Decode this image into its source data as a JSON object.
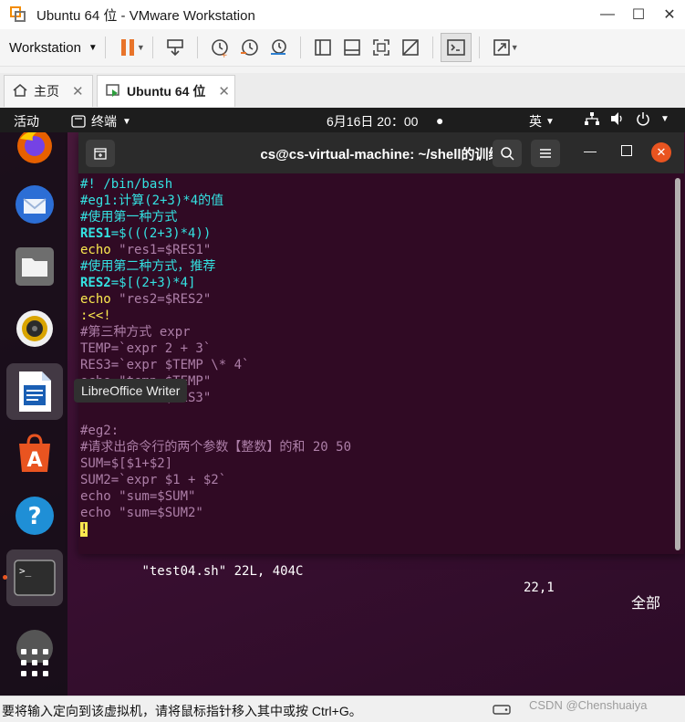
{
  "window": {
    "title": "Ubuntu 64 位 - VMware Workstation"
  },
  "toolbar": {
    "workstation_menu": "Workstation"
  },
  "tabs": [
    {
      "label": "主页"
    },
    {
      "label": "Ubuntu 64 位"
    }
  ],
  "ubuntu_bar": {
    "activities": "活动",
    "app_menu": "终端",
    "clock": "6月16日  20：00",
    "input_method": "英"
  },
  "dock": {
    "tooltip": "LibreOffice Writer"
  },
  "terminal": {
    "title": "cs@cs-virtual-machine: ~/shell的训练",
    "lines": {
      "l1": "#! /bin/bash",
      "l2": "#eg1:计算(2+3)*4的值",
      "l3": "#使用第一种方式",
      "l4a": "RES1",
      "l4b": "=$(((2+3)*4))",
      "l5a": "echo ",
      "l5b": "\"res1=$RES1\"",
      "l6": "#使用第二种方式，推荐",
      "l7a": "RES2",
      "l7b": "=$[(2+3)*4]",
      "l8a": "echo ",
      "l8b": "\"res2=$RES2\"",
      "l9": ":<<!",
      "l10": "#第三种方式 expr",
      "l11": "TEMP=`expr 2 + 3`",
      "l12": "RES3=`expr $TEMP \\* 4`",
      "l13": "echo \"temp=$TEMP\"",
      "l14": "echo \"res3=$RES3\"",
      "l15": "",
      "l16": "#eg2:",
      "l17": "#请求出命令行的两个参数【整数】的和 20 50",
      "l18": "SUM=$[$1+$2]",
      "l19": "SUM2=`expr $1 + $2`",
      "l20": "echo \"sum=$SUM\"",
      "l21": "echo \"sum=$SUM2\"",
      "l22": "!"
    },
    "status": {
      "file": "\"test04.sh\" 22L, 404C",
      "pos": "22,1",
      "all": "全部"
    }
  },
  "statusbar": {
    "message": "要将输入定向到该虚拟机，请将鼠标指针移入其中或按 Ctrl+G。",
    "watermark": "CSDN @Chenshuaiya"
  },
  "colors": {
    "terminal_bg": "#300a24",
    "cyan": "#34e2e2",
    "yellow": "#fce94f",
    "comment_purple": "#ad7fa8",
    "pause_orange": "#e8742a"
  }
}
